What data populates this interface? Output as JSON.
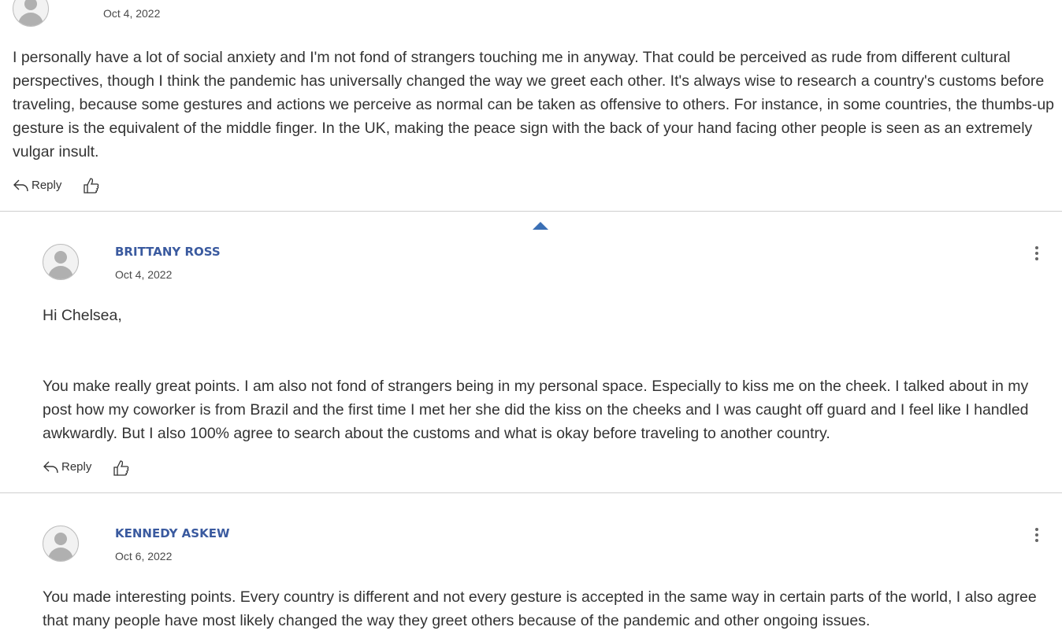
{
  "comments": [
    {
      "date": "Oct 4, 2022",
      "body": [
        "I personally have a lot of social anxiety and I'm not fond of strangers touching me in anyway.  That could be perceived as rude from different cultural perspectives, though I think the pandemic has universally changed the way we greet each other. It's always wise to research a country's customs before traveling, because some gestures and actions we perceive as normal can be taken as offensive to others. For instance, in some countries, the thumbs-up gesture is the equivalent of the middle finger. In the UK, making the peace sign with the back of your hand facing other people is seen as an extremely vulgar insult."
      ],
      "reply_label": "Reply"
    },
    {
      "author": "BRITTANY ROSS",
      "date": "Oct 4, 2022",
      "body": [
        "Hi Chelsea,",
        "You make really great points. I am also not fond of strangers being in my personal space. Especially to kiss me on the cheek. I talked about in my post how my coworker is from Brazil and the first time I met her she did the kiss on the cheeks and I was caught off guard and I feel like I handled awkwardly. But I also 100% agree to search about the customs and what is okay before traveling to another country."
      ],
      "reply_label": "Reply"
    },
    {
      "author": "KENNEDY ASKEW",
      "date": "Oct 6, 2022",
      "body": [
        "You made interesting points. Every country is different and not every gesture is accepted in the same way in certain parts of the world, I also agree that many people have most likely changed the way they greet others because of the pandemic and other ongoing issues."
      ]
    }
  ],
  "icons": {
    "reply": "reply-arrow-icon",
    "like": "thumbs-up-icon",
    "collapse": "caret-up-icon",
    "menu": "more-vertical-icon"
  },
  "colors": {
    "author": "#3a5a9f",
    "collapse_caret": "#3a6fb5",
    "text": "#333333",
    "divider": "#cfcfcf"
  }
}
